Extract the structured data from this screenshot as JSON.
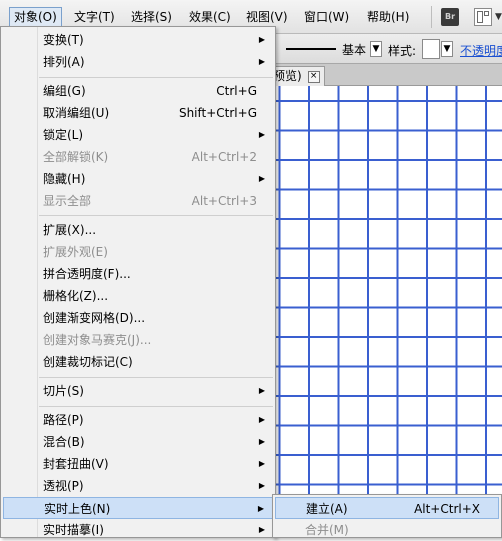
{
  "menubar": {
    "items": [
      {
        "label": "对象(O)",
        "active": true
      },
      {
        "label": "文字(T)"
      },
      {
        "label": "选择(S)"
      },
      {
        "label": "效果(C)"
      },
      {
        "label": "视图(V)"
      },
      {
        "label": "窗口(W)"
      },
      {
        "label": "帮助(H)"
      }
    ],
    "bridge_label": "Br"
  },
  "control_bar": {
    "stroke_style": "基本",
    "style_label": "样式:",
    "opacity_link": "不透明度"
  },
  "document_tab": {
    "label": "预览)",
    "close": "×"
  },
  "menu": {
    "items": [
      {
        "label": "变换(T)",
        "submenu": true
      },
      {
        "label": "排列(A)",
        "submenu": true
      },
      {
        "label": "编组(G)",
        "shortcut": "Ctrl+G"
      },
      {
        "label": "取消编组(U)",
        "shortcut": "Shift+Ctrl+G"
      },
      {
        "label": "锁定(L)",
        "submenu": true
      },
      {
        "label": "全部解锁(K)",
        "shortcut": "Alt+Ctrl+2",
        "disabled": true
      },
      {
        "label": "隐藏(H)",
        "submenu": true
      },
      {
        "label": "显示全部",
        "shortcut": "Alt+Ctrl+3",
        "disabled": true
      },
      {
        "label": "扩展(X)..."
      },
      {
        "label": "扩展外观(E)",
        "disabled": true
      },
      {
        "label": "拼合透明度(F)..."
      },
      {
        "label": "栅格化(Z)..."
      },
      {
        "label": "创建渐变网格(D)..."
      },
      {
        "label": "创建对象马赛克(J)...",
        "disabled": true
      },
      {
        "label": "创建裁切标记(C)"
      },
      {
        "label": "切片(S)",
        "submenu": true
      },
      {
        "label": "路径(P)",
        "submenu": true
      },
      {
        "label": "混合(B)",
        "submenu": true
      },
      {
        "label": "封套扭曲(V)",
        "submenu": true
      },
      {
        "label": "透视(P)",
        "submenu": true
      },
      {
        "label": "实时上色(N)",
        "submenu": true,
        "highlighted": true
      },
      {
        "label": "实时描摹(I)",
        "submenu": true
      }
    ],
    "arrow_glyph": "▶"
  },
  "submenu": {
    "items": [
      {
        "label": "建立(A)",
        "shortcut": "Alt+Ctrl+X",
        "highlighted": true
      },
      {
        "label": "合并(M)",
        "disabled": true
      }
    ]
  },
  "colors": {
    "grid_line": "#3a5fd0",
    "highlight": "#cde0f7",
    "link": "#1a4fd1"
  }
}
